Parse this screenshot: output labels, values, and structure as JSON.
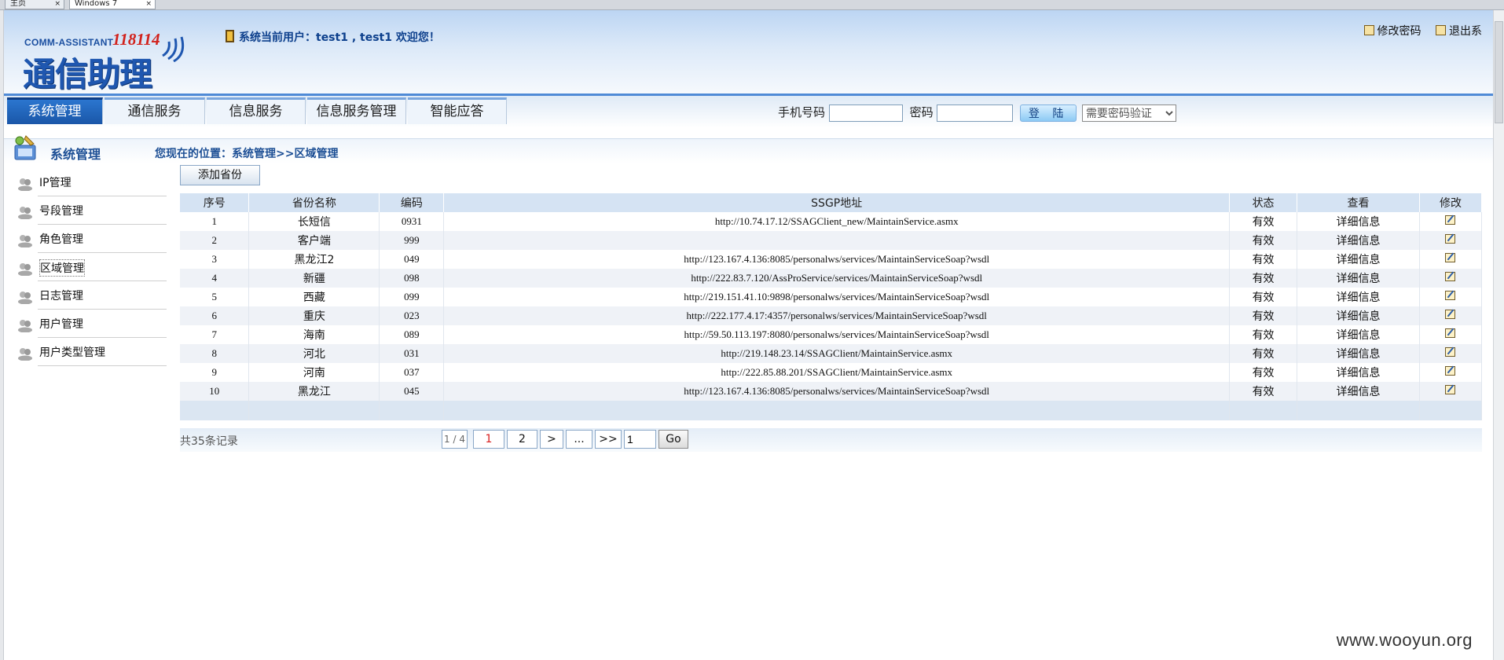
{
  "browser": {
    "tabs": [
      {
        "label": "主页"
      },
      {
        "label": "Windows 7"
      }
    ]
  },
  "header": {
    "logo_en": "COMM-ASSISTANT",
    "logo_num": "118114",
    "logo_cn": "通信助理",
    "current_user": "系统当前用户：test1 , test1 欢迎您！",
    "change_password": "修改密码",
    "logout": "退出系"
  },
  "nav": {
    "tabs": [
      {
        "label": "系统管理",
        "active": true
      },
      {
        "label": "通信服务",
        "active": false
      },
      {
        "label": "信息服务",
        "active": false
      },
      {
        "label": "信息服务管理",
        "active": false
      },
      {
        "label": "智能应答",
        "active": false
      }
    ],
    "login": {
      "phone_label": "手机号码",
      "phone_value": "",
      "password_label": "密码",
      "password_value": "",
      "login_button": "登 陆",
      "mode_selected": "需要密码验证"
    }
  },
  "breadcrumb": {
    "section_title": "系统管理",
    "path": "您现在的位置：系统管理>>区域管理"
  },
  "sidebar": {
    "items": [
      {
        "label": "IP管理"
      },
      {
        "label": "号段管理"
      },
      {
        "label": "角色管理"
      },
      {
        "label": "区域管理"
      },
      {
        "label": "日志管理"
      },
      {
        "label": "用户管理"
      },
      {
        "label": "用户类型管理"
      }
    ]
  },
  "main": {
    "add_button": "添加省份",
    "table": {
      "columns": [
        "序号",
        "省份名称",
        "编码",
        "SSGP地址",
        "状态",
        "查看",
        "修改"
      ],
      "rows": [
        {
          "no": "1",
          "name": "长短信",
          "code": "0931",
          "url": "http://10.74.17.12/SSAGClient_new/MaintainService.asmx",
          "status": "有效",
          "view": "详细信息"
        },
        {
          "no": "2",
          "name": "客户端",
          "code": "999",
          "url": "",
          "status": "有效",
          "view": "详细信息"
        },
        {
          "no": "3",
          "name": "黑龙江2",
          "code": "049",
          "url": "http://123.167.4.136:8085/personalws/services/MaintainServiceSoap?wsdl",
          "status": "有效",
          "view": "详细信息"
        },
        {
          "no": "4",
          "name": "新疆",
          "code": "098",
          "url": "http://222.83.7.120/AssProService/services/MaintainServiceSoap?wsdl",
          "status": "有效",
          "view": "详细信息"
        },
        {
          "no": "5",
          "name": "西藏",
          "code": "099",
          "url": "http://219.151.41.10:9898/personalws/services/MaintainServiceSoap?wsdl",
          "status": "有效",
          "view": "详细信息"
        },
        {
          "no": "6",
          "name": "重庆",
          "code": "023",
          "url": "http://222.177.4.17:4357/personalws/services/MaintainServiceSoap?wsdl",
          "status": "有效",
          "view": "详细信息"
        },
        {
          "no": "7",
          "name": "海南",
          "code": "089",
          "url": "http://59.50.113.197:8080/personalws/services/MaintainServiceSoap?wsdl",
          "status": "有效",
          "view": "详细信息"
        },
        {
          "no": "8",
          "name": "河北",
          "code": "031",
          "url": "http://219.148.23.14/SSAGClient/MaintainService.asmx",
          "status": "有效",
          "view": "详细信息"
        },
        {
          "no": "9",
          "name": "河南",
          "code": "037",
          "url": "http://222.85.88.201/SSAGClient/MaintainService.asmx",
          "status": "有效",
          "view": "详细信息"
        },
        {
          "no": "10",
          "name": "黑龙江",
          "code": "045",
          "url": "http://123.167.4.136:8085/personalws/services/MaintainServiceSoap?wsdl",
          "status": "有效",
          "view": "详细信息"
        }
      ]
    },
    "pager": {
      "total": "共35条记录",
      "page_info": "1 / 4",
      "current_page": "1",
      "next_page": "2",
      "next": ">",
      "ellipsis": "...",
      "last": ">>",
      "goto_value": "1",
      "go": "Go"
    }
  },
  "watermark": "www.wooyun.org",
  "colors": {
    "nav_active": "#1f5fb5",
    "header_top": "#bcd5f3",
    "link_blue": "#1d4f95",
    "table_header": "#d5e3f3"
  }
}
